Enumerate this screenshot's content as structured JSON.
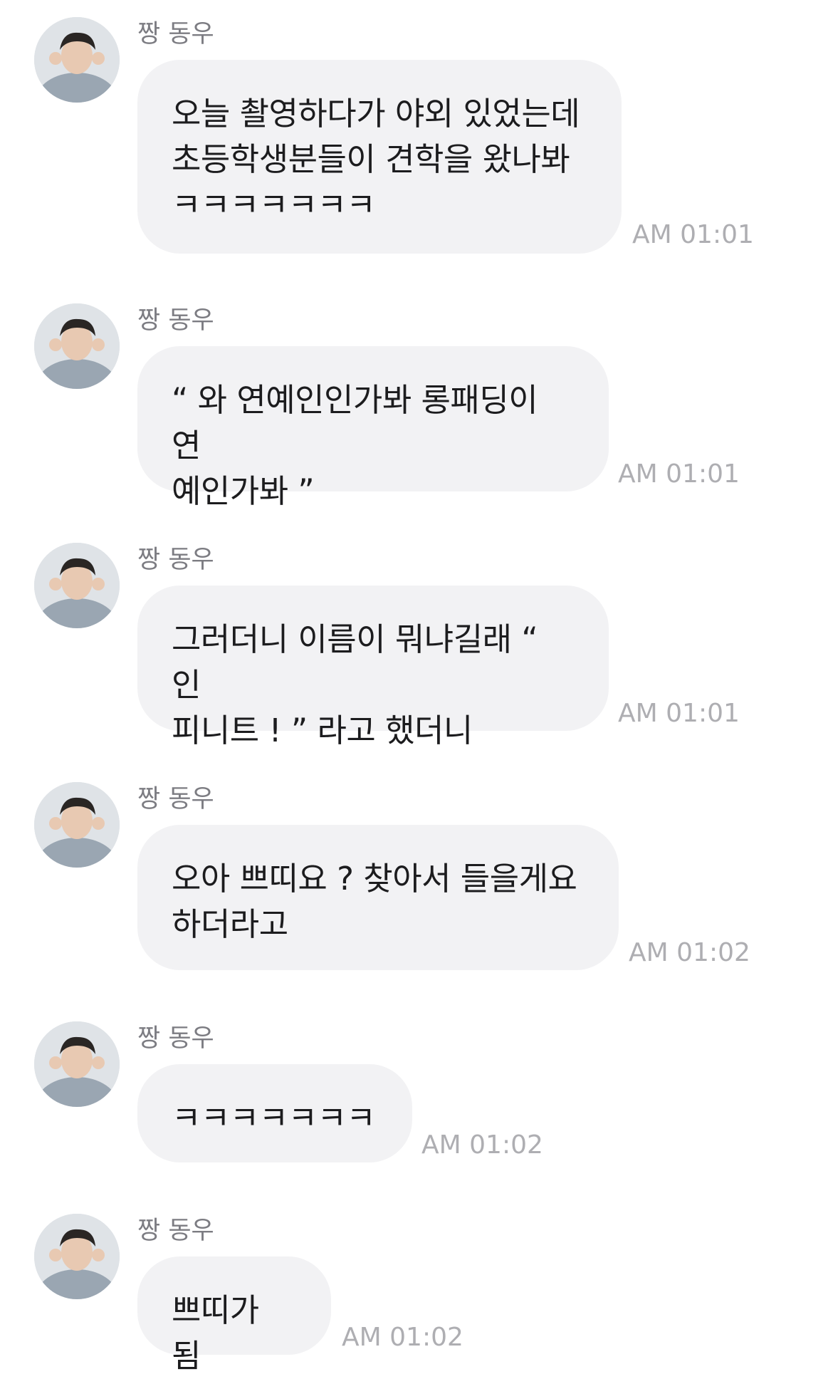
{
  "messages": [
    {
      "sender": "짱 동우",
      "text": "오늘 촬영하다가 야외 있었는데\n초등학생분들이 견학을 왔나봐\nㅋㅋㅋㅋㅋㅋㅋ",
      "time": "AM 01:01"
    },
    {
      "sender": "짱 동우",
      "text": "“ 와 연예인인가봐 롱패딩이 연\n예인가봐 ”",
      "time": "AM 01:01"
    },
    {
      "sender": "짱 동우",
      "text": "그러더니 이름이 뭐냐길래 “ 인\n피니트 ! ” 라고 했더니",
      "time": "AM 01:01"
    },
    {
      "sender": "짱 동우",
      "text": "오아 쁘띠요 ? 찾아서 들을게요\n하더라고",
      "time": "AM 01:02"
    },
    {
      "sender": "짱 동우",
      "text": "ㅋㅋㅋㅋㅋㅋㅋ",
      "time": "AM 01:02"
    },
    {
      "sender": "짱 동우",
      "text": "쁘띠가 됨",
      "time": "AM 01:02"
    }
  ],
  "colors": {
    "bubble": "#f2f2f4",
    "sender": "#7c7c82",
    "time": "#aeaeb2"
  }
}
